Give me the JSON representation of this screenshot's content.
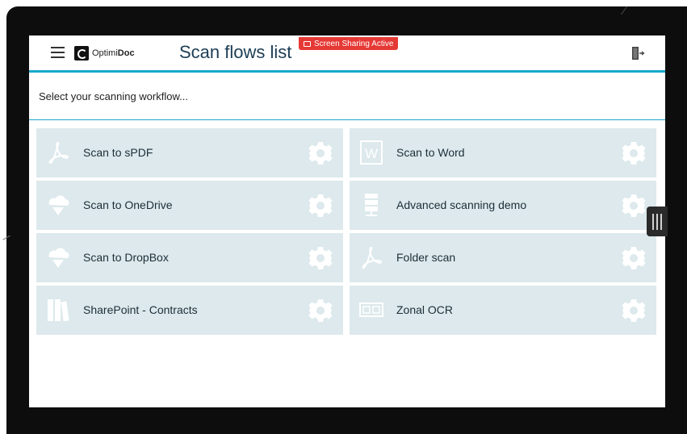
{
  "app": {
    "logo_text_light": "Optimi",
    "logo_text_bold": "Doc",
    "title": "Scan flows list",
    "share_badge": "Screen Sharing Active"
  },
  "subheader": {
    "text": "Select your scanning workflow..."
  },
  "flows": [
    {
      "label": "Scan to sPDF",
      "icon": "pdf-icon"
    },
    {
      "label": "Scan to Word",
      "icon": "word-icon"
    },
    {
      "label": "Scan to OneDrive",
      "icon": "cloud-icon"
    },
    {
      "label": "Advanced scanning demo",
      "icon": "server-icon"
    },
    {
      "label": "Scan to DropBox",
      "icon": "cloud-icon"
    },
    {
      "label": "Folder scan",
      "icon": "pdf-icon"
    },
    {
      "label": "SharePoint - Contracts",
      "icon": "books-icon"
    },
    {
      "label": "Zonal OCR",
      "icon": "ocr-icon"
    }
  ],
  "colors": {
    "accent": "#18a9c9",
    "tile_bg": "#dde9ec",
    "icon_white": "#ffffff",
    "badge": "#e53935"
  }
}
